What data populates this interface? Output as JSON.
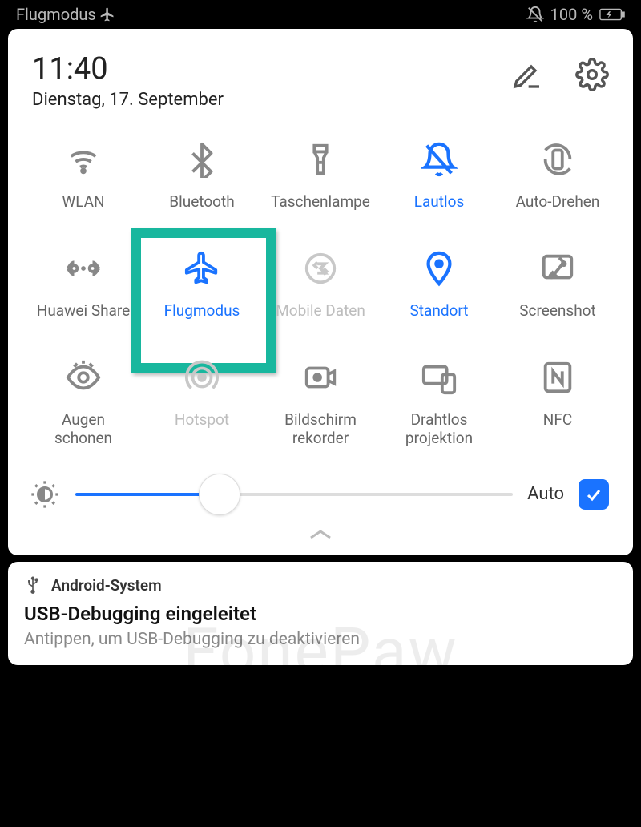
{
  "status_bar": {
    "mode_label": "Flugmodus",
    "battery_pct": "100 %"
  },
  "header": {
    "time": "11:40",
    "date": "Dienstag, 17. September"
  },
  "tiles": [
    {
      "id": "wlan",
      "label": "WLAN",
      "icon": "wifi",
      "active": false,
      "disabled": false
    },
    {
      "id": "bluetooth",
      "label": "Bluetooth",
      "icon": "bluetooth",
      "active": false,
      "disabled": false
    },
    {
      "id": "flashlight",
      "label": "Taschenlampe",
      "icon": "flashlight",
      "active": false,
      "disabled": false
    },
    {
      "id": "silent",
      "label": "Lautlos",
      "icon": "bell-off",
      "active": true,
      "disabled": false
    },
    {
      "id": "auto-rotate",
      "label": "Auto-Drehen",
      "icon": "rotate",
      "active": false,
      "disabled": false
    },
    {
      "id": "huawei-share",
      "label": "Huawei Share",
      "icon": "share",
      "active": false,
      "disabled": false
    },
    {
      "id": "airplane",
      "label": "Flugmodus",
      "icon": "airplane",
      "active": true,
      "disabled": false,
      "highlighted": true
    },
    {
      "id": "mobile-data",
      "label": "Mobile Daten",
      "icon": "data",
      "active": false,
      "disabled": true
    },
    {
      "id": "location",
      "label": "Standort",
      "icon": "location",
      "active": true,
      "disabled": false
    },
    {
      "id": "screenshot",
      "label": "Screenshot",
      "icon": "screenshot",
      "active": false,
      "disabled": false
    },
    {
      "id": "eye-comfort",
      "label": "Augen\nschonen",
      "icon": "eye",
      "active": false,
      "disabled": false
    },
    {
      "id": "hotspot",
      "label": "Hotspot",
      "icon": "hotspot",
      "active": false,
      "disabled": true
    },
    {
      "id": "screen-recorder",
      "label": "Bildschirm\nrekorder",
      "icon": "recorder",
      "active": false,
      "disabled": false
    },
    {
      "id": "wireless-projection",
      "label": "Drahtlos\nprojektion",
      "icon": "projection",
      "active": false,
      "disabled": false
    },
    {
      "id": "nfc",
      "label": "NFC",
      "icon": "nfc",
      "active": false,
      "disabled": false
    }
  ],
  "brightness": {
    "value_pct": 33,
    "auto_label": "Auto",
    "auto_checked": true
  },
  "watermark": "FonePaw",
  "notification": {
    "app": "Android-System",
    "title": "USB-Debugging eingeleitet",
    "subtitle": "Antippen, um USB-Debugging zu deaktivieren"
  }
}
